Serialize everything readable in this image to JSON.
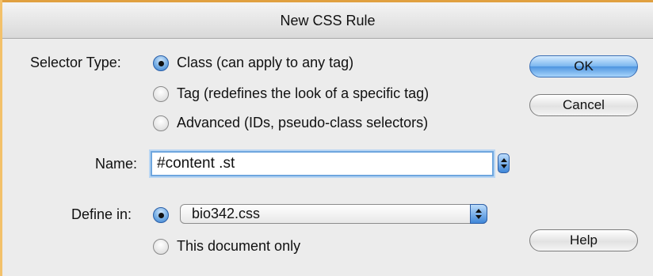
{
  "window": {
    "title": "New CSS Rule"
  },
  "selector_type": {
    "label": "Selector Type:",
    "options": [
      {
        "label": "Class (can apply to any tag)",
        "selected": true
      },
      {
        "label": "Tag (redefines the look of a specific tag)",
        "selected": false
      },
      {
        "label": "Advanced (IDs, pseudo-class selectors)",
        "selected": false
      }
    ]
  },
  "name": {
    "label": "Name:",
    "value": "#content .st"
  },
  "define_in": {
    "label": "Define in:",
    "file_option_selected": true,
    "file_value": "bio342.css",
    "doc_only_label": "This document only",
    "doc_only_selected": false
  },
  "buttons": {
    "ok": "OK",
    "cancel": "Cancel",
    "help": "Help"
  },
  "colors": {
    "accent": "#4e95e0",
    "window_edge": "#e0a040"
  }
}
